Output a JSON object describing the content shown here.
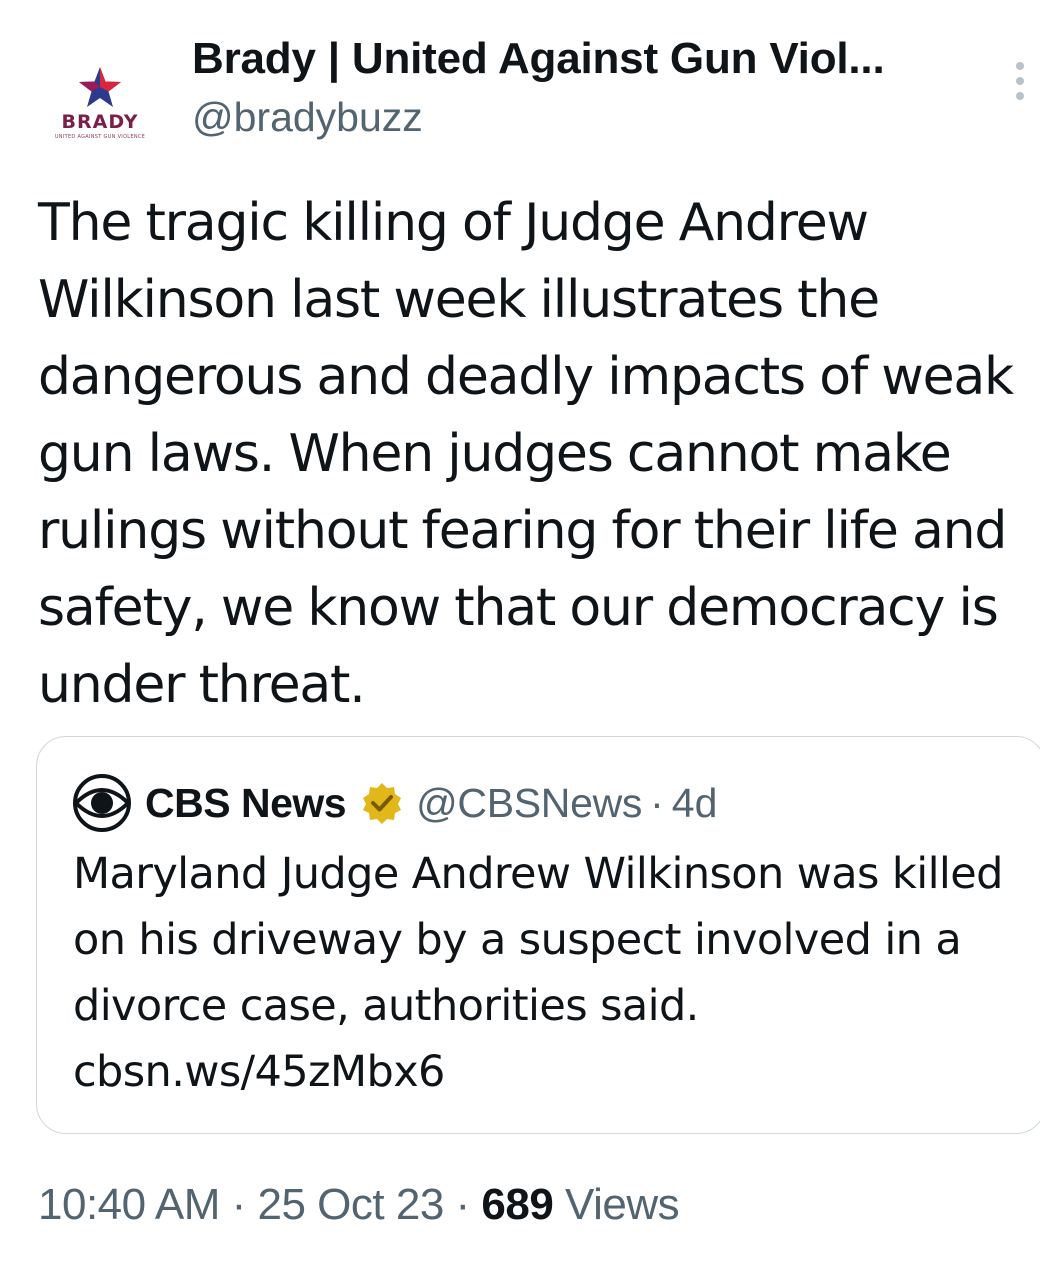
{
  "author": {
    "display_name": "Brady | United Against Gun Viol...",
    "handle": "@bradybuzz",
    "avatar": {
      "wordmark": "BRADY",
      "tagline": "UNITED AGAINST GUN VIOLENCE",
      "colors": {
        "star_red": "#d7263d",
        "star_blue": "#2b3a8f",
        "wordmark": "#7a1f4a"
      }
    }
  },
  "more_icon": "more-vertical-icon",
  "tweet": {
    "text": "The tragic killing of Judge Andrew Wilkinson last week illustrates the dangerous and deadly impacts of weak gun laws. When judges cannot make rulings without fearing for their life and safety, we know that our democracy is under threat."
  },
  "quoted_tweet": {
    "author_name": "CBS News",
    "verified_icon": "gold-verified-badge-icon",
    "handle": "@CBSNews",
    "separator": "·",
    "time": "4d",
    "text": "Maryland Judge Andrew Wilkinson was killed on his driveway by a suspect involved in a divorce case, authorities said. cbsn.ws/45zMbx6"
  },
  "meta": {
    "time": "10:40 AM",
    "dot1": " · ",
    "date": "25 Oct 23",
    "dot2": " · ",
    "views_count": "689",
    "views_label": " Views"
  },
  "colors": {
    "text_primary": "#0f1419",
    "text_secondary": "#536471",
    "border": "#cfd9de",
    "badge_gold": "#e2b719"
  }
}
